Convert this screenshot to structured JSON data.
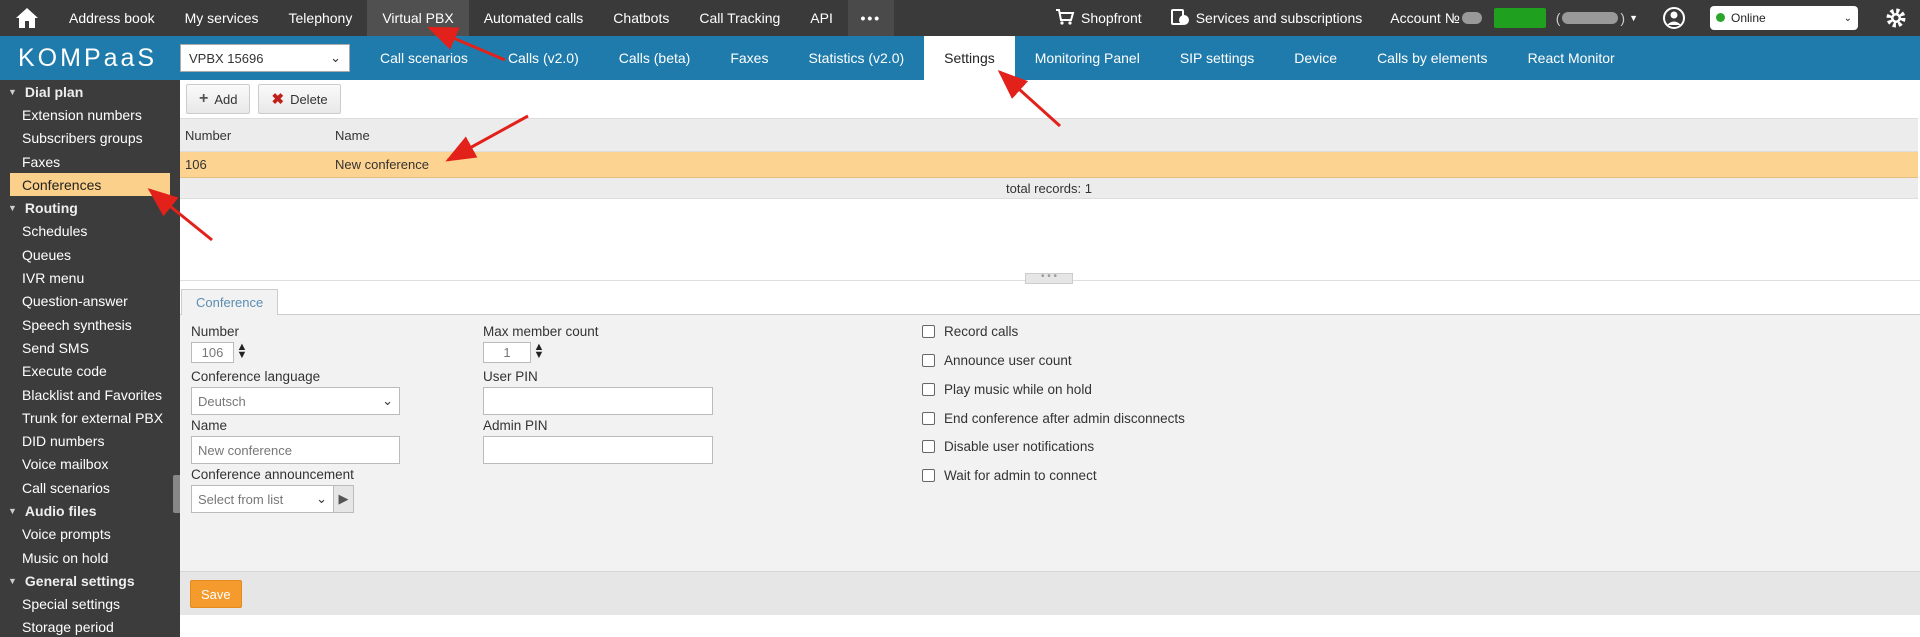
{
  "topbar": {
    "nav": [
      "Address book",
      "My services",
      "Telephony",
      "Virtual PBX",
      "Automated calls",
      "Chatbots",
      "Call Tracking",
      "API"
    ],
    "more": "•••",
    "shopfront": "Shopfront",
    "services": "Services and subscriptions",
    "account_label": "Account №",
    "status": "Online"
  },
  "subbar": {
    "logo": "KOMPaaS",
    "pbx": "VPBX 15696",
    "tabs": [
      "Call scenarios",
      "Calls (v2.0)",
      "Calls (beta)",
      "Faxes",
      "Statistics (v2.0)",
      "Settings",
      "Monitoring Panel",
      "SIP settings",
      "Device",
      "Calls by elements",
      "React Monitor"
    ],
    "active_tab": "Settings"
  },
  "sidebar": {
    "dial_plan": "Dial plan",
    "dial_items": [
      "Extension numbers",
      "Subscribers groups",
      "Faxes",
      "Conferences"
    ],
    "routing": "Routing",
    "routing_items": [
      "Schedules",
      "Queues",
      "IVR menu",
      "Question-answer",
      "Speech synthesis",
      "Send SMS",
      "Execute code",
      "Blacklist and Favorites",
      "Trunk for external PBX",
      "DID numbers",
      "Voice mailbox",
      "Call scenarios"
    ],
    "audio": "Audio files",
    "audio_items": [
      "Voice prompts",
      "Music on hold"
    ],
    "general": "General settings",
    "general_items": [
      "Special settings",
      "Storage period"
    ]
  },
  "toolbar": {
    "add": "Add",
    "delete": "Delete"
  },
  "grid": {
    "col_number": "Number",
    "col_name": "Name",
    "row_number": "106",
    "row_name": "New conference",
    "total": "total records: 1"
  },
  "form": {
    "tab": "Conference",
    "number_label": "Number",
    "number_value": "106",
    "max_label": "Max member count",
    "max_value": "1",
    "language_label": "Conference language",
    "language_value": "Deutsch",
    "user_pin_label": "User PIN",
    "name_label": "Name",
    "name_placeholder": "New conference",
    "admin_pin_label": "Admin PIN",
    "announce_label": "Conference announcement",
    "announce_value": "Select from list",
    "checkboxes": [
      "Record calls",
      "Announce user count",
      "Play music while on hold",
      "End conference after admin disconnects",
      "Disable user notifications",
      "Wait for admin to connect"
    ]
  },
  "save": "Save"
}
